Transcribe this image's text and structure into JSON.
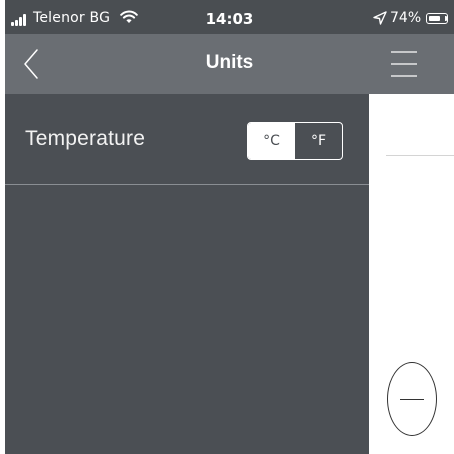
{
  "status_bar": {
    "carrier": "Telenor BG",
    "time": "14:03",
    "battery_percent": "74%",
    "battery_level": 0.74,
    "icons": [
      "signal-icon",
      "wifi-icon",
      "location-arrow-icon",
      "battery-icon"
    ]
  },
  "nav": {
    "title": "Units",
    "back_icon": "chevron-left-icon",
    "menu_icon": "hamburger-menu-icon"
  },
  "settings": {
    "temperature": {
      "label": "Temperature",
      "options": [
        "°C",
        "°F"
      ],
      "selected": "°C"
    }
  },
  "colors": {
    "status_bar": "#4a4e52",
    "nav_bar": "#6a6e73",
    "menu_panel": "#4b4f54",
    "text": "#ffffff"
  },
  "floating": {
    "icon": "minus-icon"
  }
}
